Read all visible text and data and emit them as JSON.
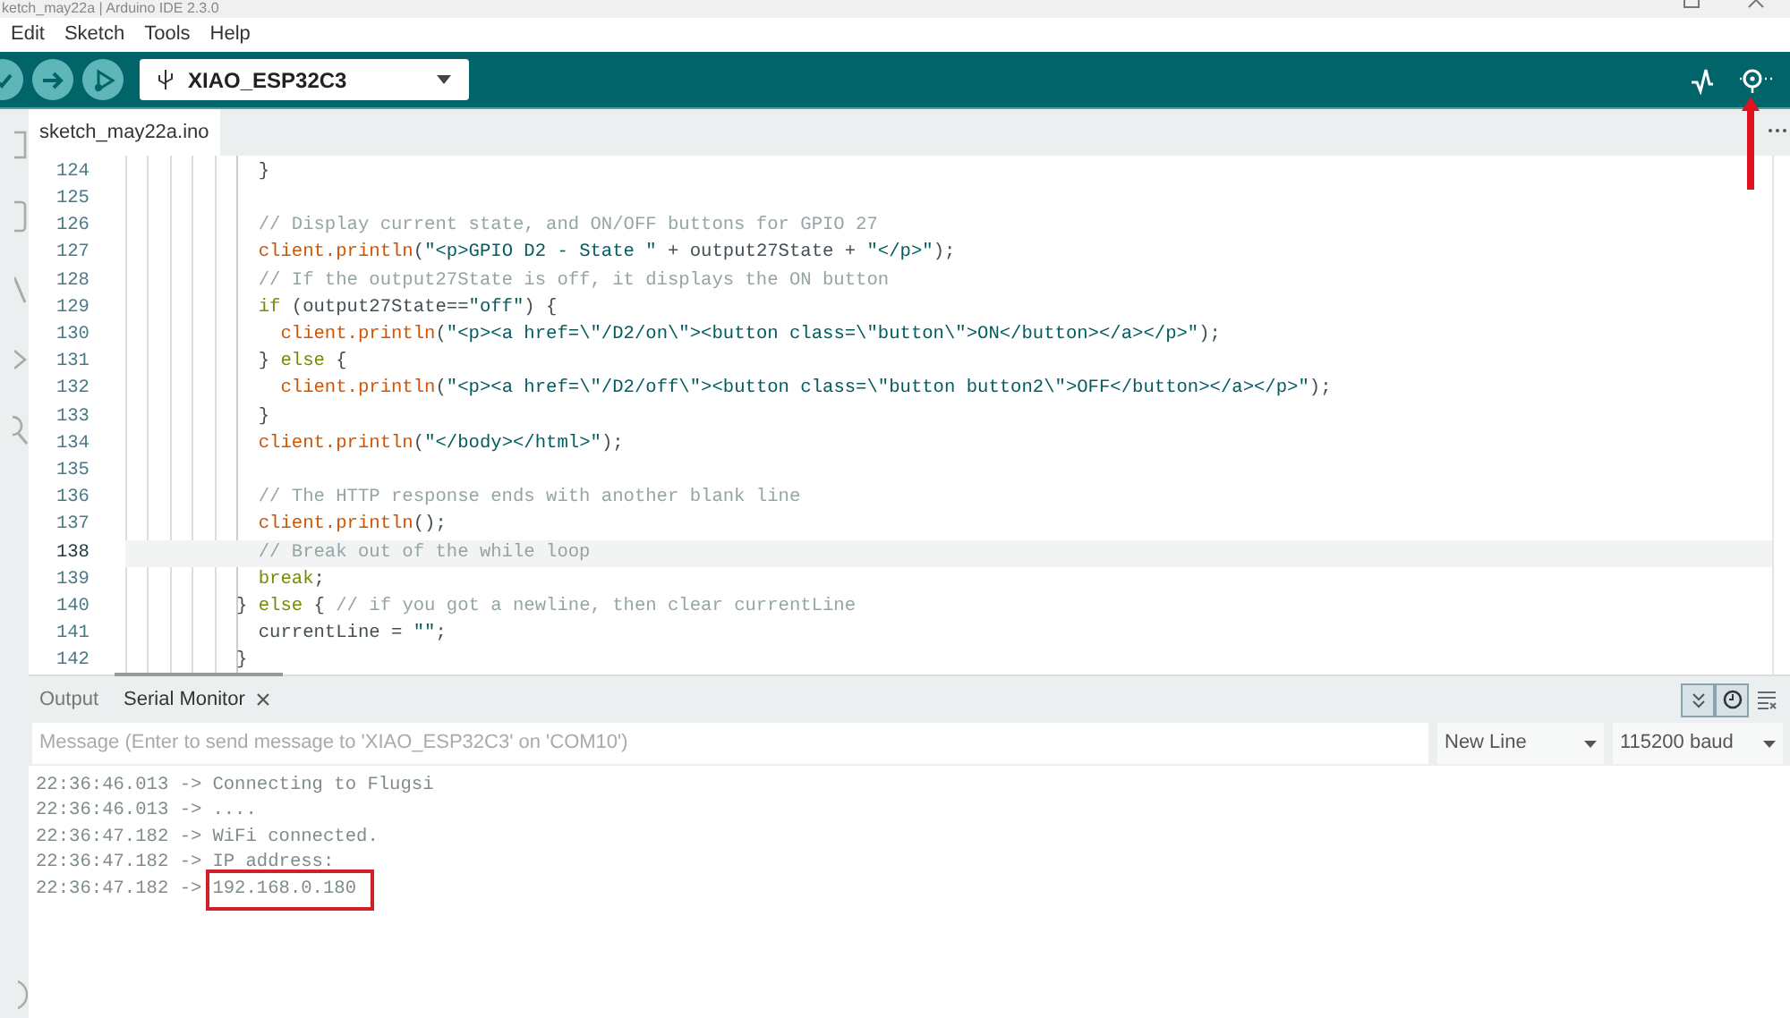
{
  "window": {
    "title": "ketch_may22a | Arduino IDE 2.3.0"
  },
  "menu": [
    "Edit",
    "Sketch",
    "Tools",
    "Help"
  ],
  "board_selector": {
    "value": "XIAO_ESP32C3"
  },
  "editor_tabs": [
    {
      "label": "sketch_may22a.ino",
      "selected": true
    }
  ],
  "editor": {
    "lines": [
      {
        "number": "124",
        "current": false,
        "segments": [
          {
            "kind": "plain",
            "text": "  }"
          }
        ]
      },
      {
        "number": "125",
        "current": false
      },
      {
        "number": "126",
        "current": false,
        "segments": [
          {
            "kind": "comment",
            "text": "  // Display current state, and ON/OFF buttons for GPIO 27"
          }
        ]
      },
      {
        "number": "127",
        "current": false,
        "segments": [
          {
            "kind": "function",
            "text": "  client.println"
          },
          {
            "kind": "plain",
            "text": "("
          },
          {
            "kind": "string",
            "text": "\"<p>GPIO D2 - State \""
          },
          {
            "kind": "plain",
            "text": " + output27State + "
          },
          {
            "kind": "string",
            "text": "\"</p>\""
          },
          {
            "kind": "plain",
            "text": ");"
          }
        ]
      },
      {
        "number": "128",
        "current": false,
        "segments": [
          {
            "kind": "comment",
            "text": "  // If the output27State is off, it displays the ON button"
          }
        ]
      },
      {
        "number": "129",
        "current": false,
        "segments": [
          {
            "kind": "keyword",
            "text": "  if"
          },
          {
            "kind": "plain",
            "text": " (output27State=="
          },
          {
            "kind": "string",
            "text": "\"off\""
          },
          {
            "kind": "plain",
            "text": ") {"
          }
        ]
      },
      {
        "number": "130",
        "current": false,
        "segments": [
          {
            "kind": "function",
            "text": "    client.println"
          },
          {
            "kind": "plain",
            "text": "("
          },
          {
            "kind": "string",
            "text": "\"<p><a href=\\\"/D2/on\\\"><button class=\\\"button\\\">ON</button></a></p>\""
          },
          {
            "kind": "plain",
            "text": ");"
          }
        ]
      },
      {
        "number": "131",
        "current": false,
        "segments": [
          {
            "kind": "plain",
            "text": "  } "
          },
          {
            "kind": "keyword",
            "text": "else"
          },
          {
            "kind": "plain",
            "text": " {"
          }
        ]
      },
      {
        "number": "132",
        "current": false,
        "segments": [
          {
            "kind": "function",
            "text": "    client.println"
          },
          {
            "kind": "plain",
            "text": "("
          },
          {
            "kind": "string",
            "text": "\"<p><a href=\\\"/D2/off\\\"><button class=\\\"button button2\\\">OFF</button></a></p>\""
          },
          {
            "kind": "plain",
            "text": ");"
          }
        ]
      },
      {
        "number": "133",
        "current": false,
        "segments": [
          {
            "kind": "plain",
            "text": "  }"
          }
        ]
      },
      {
        "number": "134",
        "current": false,
        "segments": [
          {
            "kind": "function",
            "text": "  client.println"
          },
          {
            "kind": "plain",
            "text": "("
          },
          {
            "kind": "string",
            "text": "\"</body></html>\""
          },
          {
            "kind": "plain",
            "text": ");"
          }
        ]
      },
      {
        "number": "135",
        "current": false
      },
      {
        "number": "136",
        "current": false,
        "segments": [
          {
            "kind": "comment",
            "text": "  // The HTTP response ends with another blank line"
          }
        ]
      },
      {
        "number": "137",
        "current": false,
        "segments": [
          {
            "kind": "function",
            "text": "  client.println"
          },
          {
            "kind": "plain",
            "text": "();"
          }
        ]
      },
      {
        "number": "138",
        "current": true,
        "segments": [
          {
            "kind": "comment",
            "text": "  // Break out of the while loop"
          }
        ]
      },
      {
        "number": "139",
        "current": false,
        "segments": [
          {
            "kind": "keyword",
            "text": "  break"
          },
          {
            "kind": "plain",
            "text": ";"
          }
        ]
      },
      {
        "number": "140",
        "current": false,
        "segments": [
          {
            "kind": "plain",
            "text": "} "
          },
          {
            "kind": "keyword",
            "text": "else"
          },
          {
            "kind": "plain",
            "text": " { "
          },
          {
            "kind": "comment",
            "text": "// if you got a newline, then clear currentLine"
          }
        ]
      },
      {
        "number": "141",
        "current": false,
        "segments": [
          {
            "kind": "plain",
            "text": "  currentLine = "
          },
          {
            "kind": "string",
            "text": "\"\""
          },
          {
            "kind": "plain",
            "text": ";"
          }
        ]
      },
      {
        "number": "142",
        "current": false,
        "segments": [
          {
            "kind": "plain",
            "text": "}"
          }
        ]
      }
    ]
  },
  "panel_tabs": [
    {
      "label": "Output",
      "selected": false,
      "closable": false
    },
    {
      "label": "Serial Monitor",
      "selected": true,
      "closable": true
    }
  ],
  "serial_toggles": [
    {
      "kind": "autoscroll",
      "on": true
    },
    {
      "kind": "timestamp",
      "on": true
    },
    {
      "kind": "clear",
      "on": false
    }
  ],
  "message_field": {
    "placeholder": "Message (Enter to send message to 'XIAO_ESP32C3' on 'COM10')"
  },
  "line_ending": {
    "value": "New Line"
  },
  "baud_rate": {
    "value": "115200 baud"
  },
  "serial_output": [
    {
      "prefix": "22:36:46.013 ->",
      "message": "Connecting to Flugsi",
      "highlighted": false
    },
    {
      "prefix": "22:36:46.013 ->",
      "message": "....",
      "highlighted": false
    },
    {
      "prefix": "22:36:47.182 ->",
      "message": "WiFi connected.",
      "highlighted": false
    },
    {
      "prefix": "22:36:47.182 ->",
      "message": "IP address:",
      "highlighted": false
    },
    {
      "prefix": "22:36:47.182 ->",
      "message": "192.168.0.180",
      "highlighted": true
    }
  ]
}
